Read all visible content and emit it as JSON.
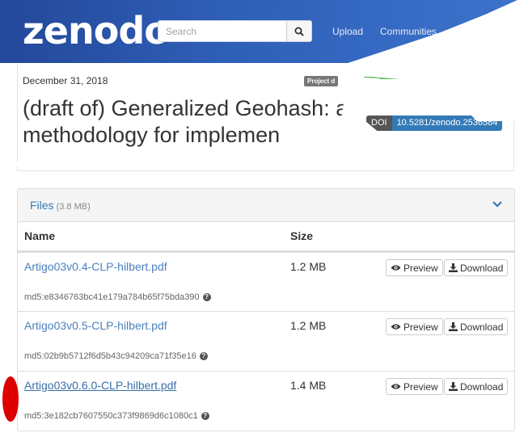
{
  "nav": {
    "logo": "zenodo",
    "search_placeholder": "Search",
    "upload": "Upload",
    "communities": "Communities"
  },
  "record": {
    "date": "December 31, 2018",
    "badge": "Project d",
    "title": "(draft of) Generalized Geohash: a methodology for implemen",
    "doi_label": "DOI",
    "doi_value": "10.5281/zenodo.2536584"
  },
  "files": {
    "title": "Files",
    "total_size": "(3.8 MB)",
    "col_name": "Name",
    "col_size": "Size",
    "preview_label": "Preview",
    "download_label": "Download",
    "rows": [
      {
        "name": "Artigo03v0.4-CLP-hilbert.pdf",
        "size": "1.2 MB",
        "md5": "md5:e8346763bc41e179a784b65f75bda390"
      },
      {
        "name": "Artigo03v0.5-CLP-hilbert.pdf",
        "size": "1.2 MB",
        "md5": "md5:02b9b5712f6d5b43c94209ca71f35e16"
      },
      {
        "name": "Artigo03v0.6.0-CLP-hilbert.pdf",
        "size": "1.4 MB",
        "md5": "md5:3e182cb7607550c373f9869d6c1080c1"
      }
    ]
  },
  "colors": {
    "brand_blue": "#2f60b8",
    "link": "#4a80bf",
    "doi_blue": "#337ab7",
    "annotation_red": "#dd0000"
  }
}
